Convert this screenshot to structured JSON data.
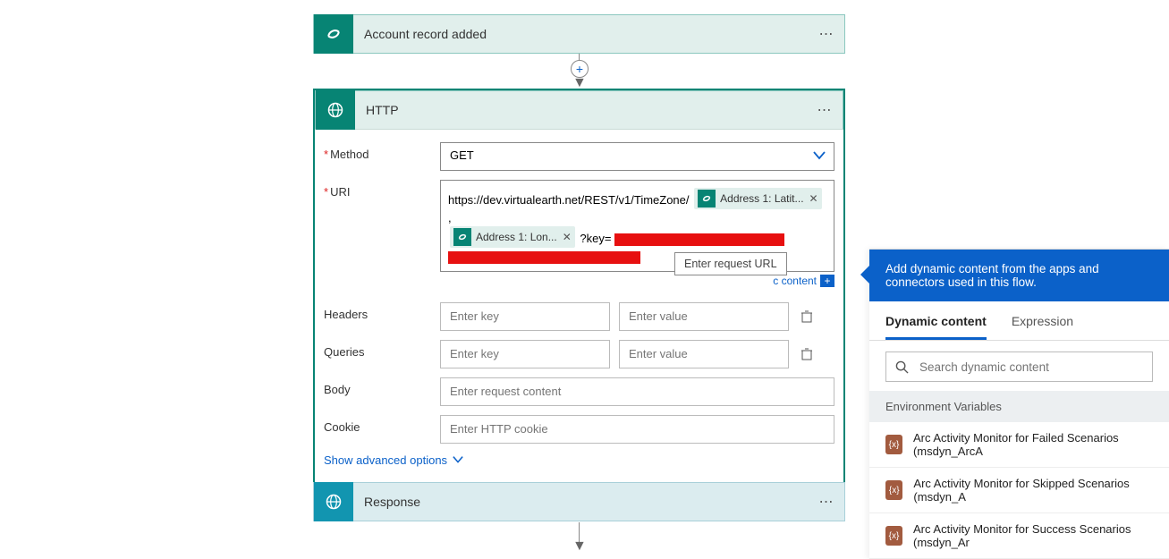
{
  "trigger": {
    "title": "Account record added"
  },
  "http": {
    "title": "HTTP",
    "method": {
      "label": "Method",
      "value": "GET"
    },
    "uri": {
      "label": "URI",
      "prefix": "https://dev.virtualearth.net/REST/v1/TimeZone/",
      "token1": "Address 1: Latit...",
      "comma": ",",
      "token2": "Address 1: Lon...",
      "keytxt": "?key=",
      "tooltip": "Enter request URL"
    },
    "dynamic_link_text": "c content",
    "headers": {
      "label": "Headers",
      "ph_key": "Enter key",
      "ph_val": "Enter value"
    },
    "queries": {
      "label": "Queries",
      "ph_key": "Enter key",
      "ph_val": "Enter value"
    },
    "body": {
      "label": "Body",
      "ph": "Enter request content"
    },
    "cookie": {
      "label": "Cookie",
      "ph": "Enter HTTP cookie"
    },
    "adv": "Show advanced options"
  },
  "response": {
    "title": "Response"
  },
  "panel": {
    "headline": "Add dynamic content from the apps and connectors used in this flow.",
    "tab1": "Dynamic content",
    "tab2": "Expression",
    "search_ph": "Search dynamic content",
    "section": "Environment Variables",
    "items": [
      "Arc Activity Monitor for Failed Scenarios (msdyn_ArcA",
      "Arc Activity Monitor for Skipped Scenarios (msdyn_A",
      "Arc Activity Monitor for Success Scenarios (msdyn_Ar"
    ]
  }
}
